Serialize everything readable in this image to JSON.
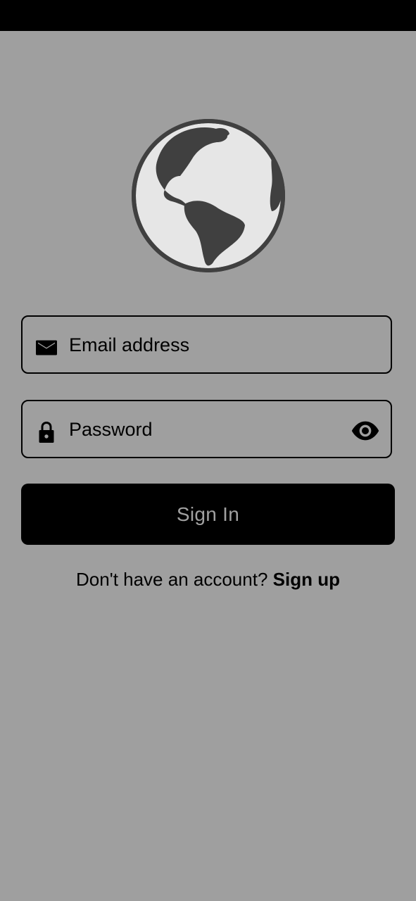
{
  "status_bar": {},
  "logo": {
    "icon": "globe-icon"
  },
  "email": {
    "placeholder": "Email address",
    "value": "",
    "icon": "mail-icon"
  },
  "password": {
    "placeholder": "Password",
    "value": "",
    "icon": "lock-icon",
    "toggle_icon": "eye-icon"
  },
  "signin": {
    "label": "Sign In"
  },
  "signup": {
    "prompt": "Don't have an account?",
    "link_label": "Sign up"
  },
  "colors": {
    "background": "#9f9f9f",
    "button": "#000000",
    "button_text": "#a0a0a0",
    "globe_fill": "#e6e6e6",
    "globe_dark": "#404040"
  }
}
